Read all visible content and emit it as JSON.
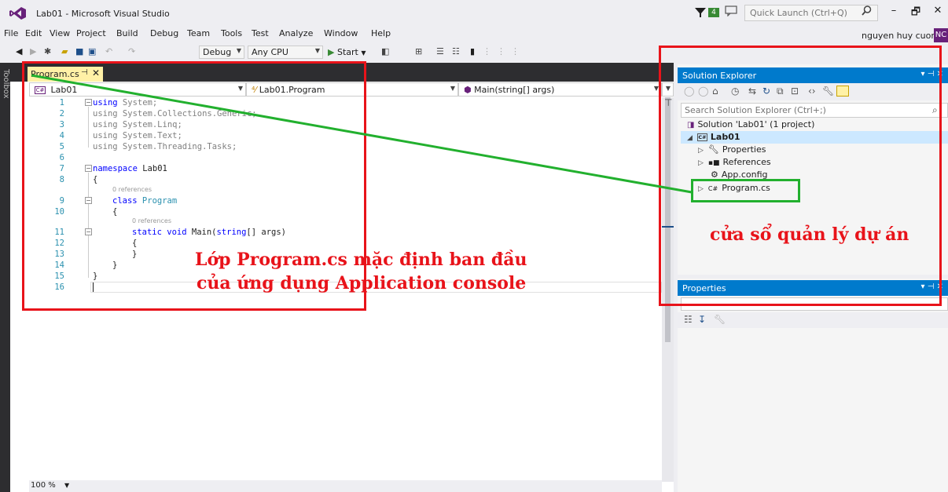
{
  "window": {
    "title": "Lab01 - Microsoft Visual Studio",
    "notification_count": "4",
    "quick_launch_placeholder": "Quick Launch (Ctrl+Q)",
    "user_name": "nguyen huy cuong",
    "user_initials": "NC",
    "minimize": "–",
    "restore": "🗗",
    "close": "✕"
  },
  "menu": [
    "File",
    "Edit",
    "View",
    "Project",
    "Build",
    "Debug",
    "Team",
    "Tools",
    "Test",
    "Analyze",
    "Window",
    "Help"
  ],
  "toolbar": {
    "config": "Debug",
    "platform": "Any CPU",
    "start": "Start"
  },
  "toolbox_label": "Toolbox",
  "editor": {
    "tab_label": "Program.cs",
    "tab_pin": "⊣",
    "tab_close": "✕",
    "nav_project": "Lab01",
    "nav_class": "Lab01.Program",
    "nav_member": "Main(string[] args)",
    "references_label": "0 references",
    "zoom": "100 %",
    "line_numbers": [
      "1",
      "2",
      "3",
      "4",
      "5",
      "6",
      "7",
      "8",
      "9",
      "10",
      "11",
      "12",
      "13",
      "14",
      "15",
      "16"
    ],
    "code": {
      "l1_kw": "using",
      "l1_rest": " System;",
      "l2": "using System.Collections.Generic;",
      "l3": "using System.Linq;",
      "l4": "using System.Text;",
      "l5": "using System.Threading.Tasks;",
      "l7_kw": "namespace",
      "l7_rest": " Lab01",
      "l8": "{",
      "l9_kw": "class",
      "l9_type": " Program",
      "l10": "{",
      "l11_kw1": "static",
      "l11_kw2": " void",
      "l11_rest1": " Main(",
      "l11_kw3": "string",
      "l11_rest2": "[] args)",
      "l12": "{",
      "l13": "}",
      "l14": "}",
      "l15": "}"
    }
  },
  "solution_explorer": {
    "title": "Solution Explorer",
    "search_placeholder": "Search Solution Explorer (Ctrl+;)",
    "solution": "Solution 'Lab01' (1 project)",
    "project": "Lab01",
    "items": [
      "Properties",
      "References",
      "App.config",
      "Program.cs"
    ]
  },
  "properties_panel": {
    "title": "Properties"
  },
  "annotations": {
    "editor_caption_line1": "Lớp Program.cs mặc định ban đầu",
    "editor_caption_line2": "của  ứng dụng Application console",
    "se_caption": "cửa sổ quản lý dự án"
  },
  "colors": {
    "accent": "#007acc",
    "annotation_red": "#e8131a",
    "annotation_green": "#22b02e",
    "tab_active": "#fff1a6"
  }
}
